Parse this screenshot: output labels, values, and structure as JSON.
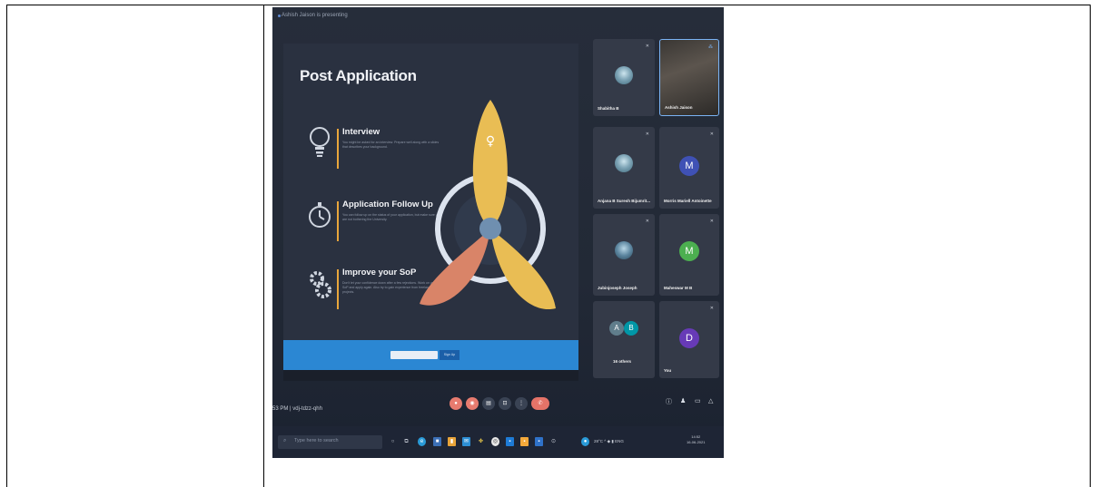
{
  "document": {
    "left_cell": "",
    "right_cell_blank": ""
  },
  "meeting": {
    "presenter_banner": "Ashish Jaison is presenting",
    "time_and_code": "53 PM  |  vdj-tdzz-qhh",
    "controls": [
      "mic",
      "camera",
      "captions",
      "present",
      "more",
      "leave"
    ],
    "right_controls": [
      "info",
      "people",
      "chat",
      "activities"
    ],
    "accent_colors": {
      "control_red": "#e77b6f",
      "tile_bg": "#343a48",
      "avatar_m": "#3f51b5",
      "avatar_m2": "#4caf50",
      "avatar_d": "#673ab7"
    }
  },
  "slide": {
    "title": "Post Application",
    "items": [
      {
        "icon": "lightbulb-icon",
        "title": "Interview",
        "text": "You might be asked for an interview. Prepare well along with a slides that describes your background."
      },
      {
        "icon": "stopwatch-icon",
        "title": "Application Follow Up",
        "text": "You can follow up on the status of your application, but make sure you are not bothering the University."
      },
      {
        "icon": "gears-icon",
        "title": "Improve your SoP",
        "text": "Don't let your confidence down after a few rejections. Work on your SoP and apply again. Also try to gain experience from freelance projects."
      }
    ],
    "footer_button": "Sign Up"
  },
  "participants": [
    {
      "name": "Shabitha B",
      "kind": "photo"
    },
    {
      "name": "Ashish Jaison",
      "kind": "camera"
    },
    {
      "name": "Anjana B Suresh Bijumrit...",
      "kind": "photo"
    },
    {
      "name": "Morris Mariell Antoinette",
      "kind": "letter",
      "letter": "M"
    },
    {
      "name": "Jubinjoseph Joseph",
      "kind": "photo"
    },
    {
      "name": "Maheswar M B",
      "kind": "letter",
      "letter": "M"
    },
    {
      "name": "16 others",
      "kind": "group",
      "letters": [
        "A",
        "B"
      ]
    },
    {
      "name": "You",
      "kind": "letter",
      "letter": "D"
    }
  ],
  "taskbar": {
    "search_placeholder": "Type here to search",
    "tray_text": "28°C  ^  ◆  ▮  ENG",
    "clock_time": "14:52",
    "clock_date": "16-06-2021"
  }
}
